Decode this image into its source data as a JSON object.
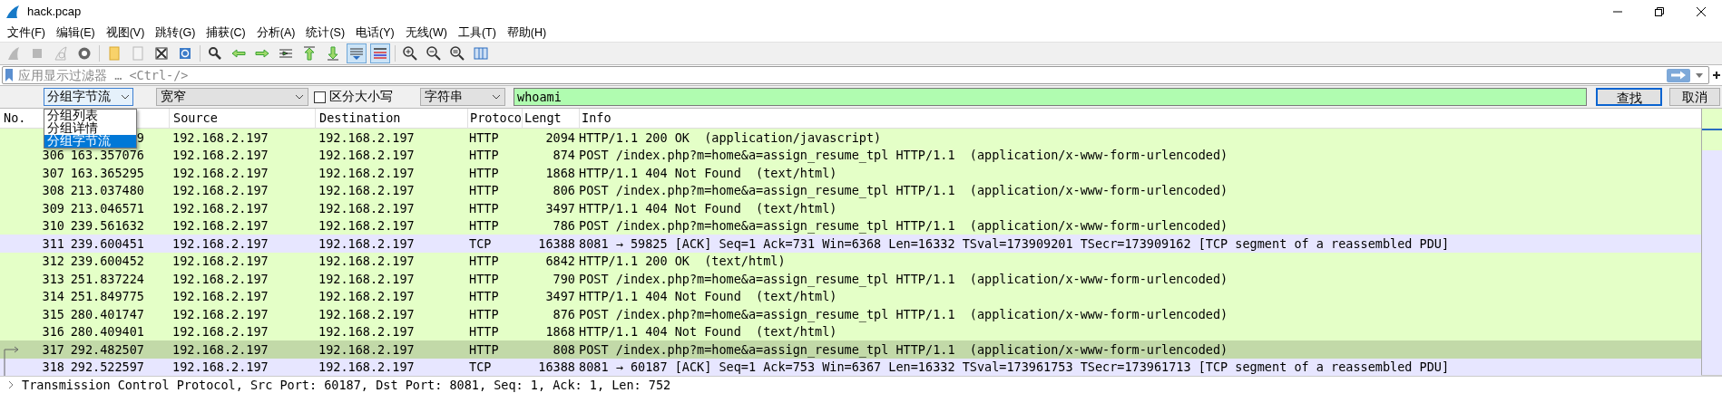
{
  "window": {
    "title": "hack.pcap"
  },
  "menu": [
    "文件(F)",
    "编辑(E)",
    "视图(V)",
    "跳转(G)",
    "捕获(C)",
    "分析(A)",
    "统计(S)",
    "电话(Y)",
    "无线(W)",
    "工具(T)",
    "帮助(H)"
  ],
  "toolbar": [
    {
      "kind": "fin",
      "disabled": true,
      "pressed": false
    },
    {
      "kind": "stop",
      "disabled": true,
      "pressed": false
    },
    {
      "kind": "restart",
      "disabled": true,
      "pressed": false
    },
    {
      "kind": "gear",
      "disabled": false,
      "pressed": false
    },
    {
      "kind": "sep"
    },
    {
      "kind": "folder",
      "disabled": false,
      "pressed": false
    },
    {
      "kind": "file",
      "disabled": true,
      "pressed": false
    },
    {
      "kind": "close",
      "disabled": false,
      "pressed": false
    },
    {
      "kind": "reload",
      "disabled": false,
      "pressed": false
    },
    {
      "kind": "sep"
    },
    {
      "kind": "search",
      "disabled": false,
      "pressed": false
    },
    {
      "kind": "back",
      "disabled": false,
      "pressed": false
    },
    {
      "kind": "forward",
      "disabled": false,
      "pressed": false
    },
    {
      "kind": "goto",
      "disabled": false,
      "pressed": false
    },
    {
      "kind": "first",
      "disabled": false,
      "pressed": false
    },
    {
      "kind": "last",
      "disabled": false,
      "pressed": false
    },
    {
      "kind": "autoscroll",
      "disabled": false,
      "pressed": true
    },
    {
      "kind": "colorize",
      "disabled": false,
      "pressed": true
    },
    {
      "kind": "sep"
    },
    {
      "kind": "zoom-in",
      "disabled": false,
      "pressed": false
    },
    {
      "kind": "zoom-out",
      "disabled": false,
      "pressed": false
    },
    {
      "kind": "zoom-reset",
      "disabled": false,
      "pressed": false
    },
    {
      "kind": "columns",
      "disabled": false,
      "pressed": false
    }
  ],
  "filter": {
    "placeholder": "应用显示过滤器 … <Ctrl-/>"
  },
  "find_bar": {
    "search_in": "分组字节流",
    "search_in_options": [
      {
        "label": "分组列表",
        "selected": false
      },
      {
        "label": "分组详情",
        "selected": false
      },
      {
        "label": "分组字节流",
        "selected": true
      }
    ],
    "charset": "宽窄",
    "case_sensitive": {
      "label": "区分大小写",
      "checked": false
    },
    "search_type": "字符串",
    "query": "whoami",
    "find_button": "查找",
    "cancel_button": "取消"
  },
  "table": {
    "columns": [
      "No.",
      "Source",
      "Destination",
      "Protoco",
      "Lengt",
      "Info"
    ],
    "rows": [
      {
        "time": "9",
        "source": "192.168.2.197",
        "destination": "192.168.2.197",
        "protocol": "HTTP",
        "length": "2094",
        "info": "HTTP/1.1 200 OK  (application/javascript)",
        "kind": "http",
        "selected": false,
        "related_arrow": false,
        "related_line": false
      },
      {
        "no": "306",
        "time": "163.357076",
        "source": "192.168.2.197",
        "destination": "192.168.2.197",
        "protocol": "HTTP",
        "length": "874",
        "info": "POST /index.php?m=home&a=assign_resume_tpl HTTP/1.1  (application/x-www-form-urlencoded)",
        "kind": "http",
        "selected": false,
        "related_arrow": false,
        "related_line": false
      },
      {
        "no": "307",
        "time": "163.365295",
        "source": "192.168.2.197",
        "destination": "192.168.2.197",
        "protocol": "HTTP",
        "length": "1868",
        "info": "HTTP/1.1 404 Not Found  (text/html)",
        "kind": "http",
        "selected": false,
        "related_arrow": false,
        "related_line": false
      },
      {
        "no": "308",
        "time": "213.037480",
        "source": "192.168.2.197",
        "destination": "192.168.2.197",
        "protocol": "HTTP",
        "length": "806",
        "info": "POST /index.php?m=home&a=assign_resume_tpl HTTP/1.1  (application/x-www-form-urlencoded)",
        "kind": "http",
        "selected": false,
        "related_arrow": false,
        "related_line": false
      },
      {
        "no": "309",
        "time": "213.046571",
        "source": "192.168.2.197",
        "destination": "192.168.2.197",
        "protocol": "HTTP",
        "length": "3497",
        "info": "HTTP/1.1 404 Not Found  (text/html)",
        "kind": "http",
        "selected": false,
        "related_arrow": false,
        "related_line": false
      },
      {
        "no": "310",
        "time": "239.561632",
        "source": "192.168.2.197",
        "destination": "192.168.2.197",
        "protocol": "HTTP",
        "length": "786",
        "info": "POST /index.php?m=home&a=assign_resume_tpl HTTP/1.1  (application/x-www-form-urlencoded)",
        "kind": "http",
        "selected": false,
        "related_arrow": false,
        "related_line": false
      },
      {
        "no": "311",
        "time": "239.600451",
        "source": "192.168.2.197",
        "destination": "192.168.2.197",
        "protocol": "TCP",
        "length": "16388",
        "info": "8081 → 59825 [ACK] Seq=1 Ack=731 Win=6368 Len=16332 TSval=173909201 TSecr=173909162 [TCP segment of a reassembled PDU]",
        "kind": "tcp",
        "selected": false,
        "related_arrow": false,
        "related_line": false
      },
      {
        "no": "312",
        "time": "239.600452",
        "source": "192.168.2.197",
        "destination": "192.168.2.197",
        "protocol": "HTTP",
        "length": "6842",
        "info": "HTTP/1.1 200 OK  (text/html)",
        "kind": "http",
        "selected": false,
        "related_arrow": false,
        "related_line": false
      },
      {
        "no": "313",
        "time": "251.837224",
        "source": "192.168.2.197",
        "destination": "192.168.2.197",
        "protocol": "HTTP",
        "length": "790",
        "info": "POST /index.php?m=home&a=assign_resume_tpl HTTP/1.1  (application/x-www-form-urlencoded)",
        "kind": "http",
        "selected": false,
        "related_arrow": false,
        "related_line": false
      },
      {
        "no": "314",
        "time": "251.849775",
        "source": "192.168.2.197",
        "destination": "192.168.2.197",
        "protocol": "HTTP",
        "length": "3497",
        "info": "HTTP/1.1 404 Not Found  (text/html)",
        "kind": "http",
        "selected": false,
        "related_arrow": false,
        "related_line": false
      },
      {
        "no": "315",
        "time": "280.401747",
        "source": "192.168.2.197",
        "destination": "192.168.2.197",
        "protocol": "HTTP",
        "length": "876",
        "info": "POST /index.php?m=home&a=assign_resume_tpl HTTP/1.1  (application/x-www-form-urlencoded)",
        "kind": "http",
        "selected": false,
        "related_arrow": false,
        "related_line": false
      },
      {
        "no": "316",
        "time": "280.409401",
        "source": "192.168.2.197",
        "destination": "192.168.2.197",
        "protocol": "HTTP",
        "length": "1868",
        "info": "HTTP/1.1 404 Not Found  (text/html)",
        "kind": "http",
        "selected": false,
        "related_arrow": false,
        "related_line": false
      },
      {
        "no": "317",
        "time": "292.482507",
        "source": "192.168.2.197",
        "destination": "192.168.2.197",
        "protocol": "HTTP",
        "length": "808",
        "info": "POST /index.php?m=home&a=assign_resume_tpl HTTP/1.1  (application/x-www-form-urlencoded)",
        "kind": "http",
        "selected": true,
        "related_arrow": true,
        "related_line": false
      },
      {
        "no": "318",
        "time": "292.522597",
        "source": "192.168.2.197",
        "destination": "192.168.2.197",
        "protocol": "TCP",
        "length": "16388",
        "info": "8081 → 60187 [ACK] Seq=1 Ack=753 Win=6367 Len=16332 TSval=173961753 TSecr=173961713 [TCP segment of a reassembled PDU]",
        "kind": "tcp",
        "selected": false,
        "related_arrow": false,
        "related_line": true
      }
    ]
  },
  "details": {
    "line": "Transmission Control Protocol, Src Port: 60187, Dst Port: 8081, Seq: 1, Ack: 1, Len: 752",
    "expanded": false
  }
}
